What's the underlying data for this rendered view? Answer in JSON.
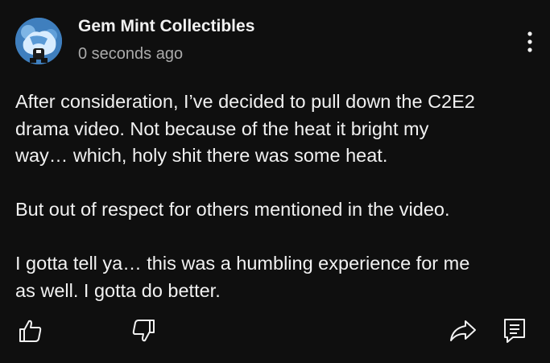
{
  "post": {
    "channel_name": "Gem Mint Collectibles",
    "timestamp": "0 seconds ago",
    "paragraphs": [
      "After consideration, I’ve decided to pull down the C2E2\ndrama video. Not because of the heat it bright my\nway… which, holy shit there was some heat.",
      "But out of respect for others mentioned in the video.",
      "I gotta tell ya… this was a humbling experience for me\nas well. I gotta do better."
    ]
  },
  "icons": {
    "avatar": "channel-avatar",
    "menu": "vertical-ellipsis-icon",
    "like": "thumbs-up-icon",
    "dislike": "thumbs-down-icon",
    "share": "share-arrow-icon",
    "comment": "comment-icon"
  },
  "colors": {
    "background": "#0f0f0f",
    "primary_text": "#f1f1f1",
    "secondary_text": "#aaaaaa"
  }
}
